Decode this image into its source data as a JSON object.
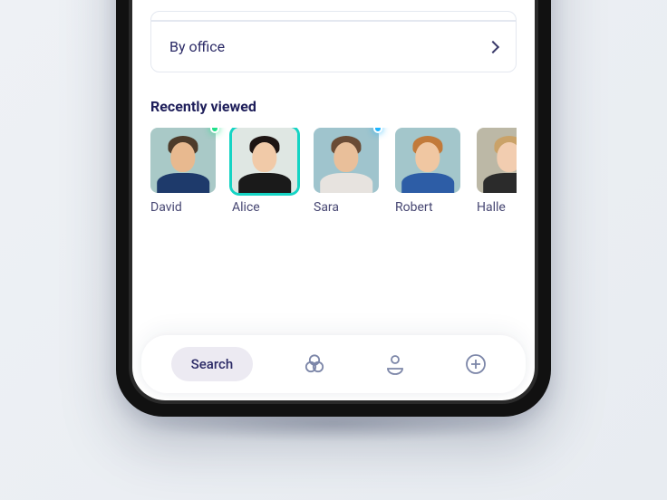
{
  "filters": {
    "by_office": "By office"
  },
  "recently_viewed": {
    "title": "Recently viewed",
    "people": [
      {
        "name": "David",
        "status": "green",
        "selected": false,
        "bg": "#a9c9c7",
        "skin": "#e8b98f",
        "hair": "#4d3b2a",
        "shirt": "#1e3a6b"
      },
      {
        "name": "Alice",
        "status": null,
        "selected": true,
        "bg": "#dfe7e3",
        "skin": "#f1caa8",
        "hair": "#1e1513",
        "shirt": "#1a1a1a"
      },
      {
        "name": "Sara",
        "status": "blue",
        "selected": false,
        "bg": "#9fc4cd",
        "skin": "#e9bf9a",
        "hair": "#6a4b35",
        "shirt": "#e7e3df"
      },
      {
        "name": "Robert",
        "status": null,
        "selected": false,
        "bg": "#a3c6cb",
        "skin": "#f0c7a2",
        "hair": "#c27a3a",
        "shirt": "#2d5da6"
      },
      {
        "name": "Halle",
        "status": null,
        "selected": false,
        "bg": "#bcb8a6",
        "skin": "#f2cdb0",
        "hair": "#caa268",
        "shirt": "#2b2b2b"
      }
    ]
  },
  "nav": {
    "search_label": "Search"
  }
}
